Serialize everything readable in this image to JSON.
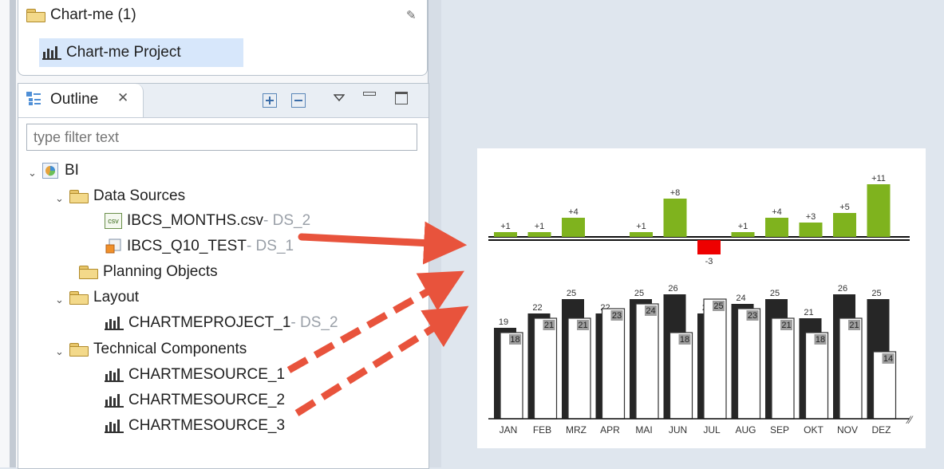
{
  "projects": {
    "root_label": "Chart-me (1)",
    "project_label": "Chart-me Project"
  },
  "outline": {
    "tab_label": "Outline",
    "filter_placeholder": "type filter text",
    "tree": {
      "root": "BI",
      "data_sources": "Data Sources",
      "ds_file_1": "IBCS_MONTHS.csv",
      "ds_file_1_suffix": " - DS_2",
      "ds_file_2": "IBCS_Q10_TEST",
      "ds_file_2_suffix": " - DS_1",
      "planning": "Planning Objects",
      "layout": "Layout",
      "layout_item": "CHARTMEPROJECT_1",
      "layout_item_suffix": " - DS_2",
      "technical": "Technical Components",
      "source_1": "CHARTMESOURCE_1",
      "source_2": "CHARTMESOURCE_2",
      "source_3": "CHARTMESOURCE_3"
    }
  },
  "chart_data": [
    {
      "type": "bar",
      "categories": [
        "JAN",
        "FEB",
        "MRZ",
        "APR",
        "MAI",
        "JUN",
        "JUL",
        "AUG",
        "SEP",
        "OKT",
        "NOV",
        "DEZ"
      ],
      "values": [
        1,
        1,
        4,
        null,
        1,
        8,
        -3,
        1,
        4,
        3,
        5,
        11
      ],
      "labels": [
        "+1",
        "+1",
        "+4",
        "",
        "+1",
        "+8",
        "-3",
        "+1",
        "+4",
        "+3",
        "+5",
        "+11"
      ],
      "colors": {
        "positive": "#7fb31e",
        "negative": "#ee0000",
        "axis": "#111111"
      }
    },
    {
      "type": "bar",
      "categories": [
        "JAN",
        "FEB",
        "MRZ",
        "APR",
        "MAI",
        "JUN",
        "JUL",
        "AUG",
        "SEP",
        "OKT",
        "NOV",
        "DEZ"
      ],
      "series": [
        {
          "values": [
            19,
            22,
            25,
            22,
            25,
            26,
            22,
            24,
            25,
            21,
            26,
            25
          ],
          "labels": [
            "19",
            "22",
            "25",
            "22",
            "25",
            "26",
            "22",
            "24",
            "25",
            "21",
            "26",
            "25"
          ]
        },
        {
          "values": [
            18,
            21,
            21,
            23,
            24,
            18,
            25,
            23,
            21,
            18,
            21,
            14
          ],
          "labels": [
            "18",
            "21",
            "21",
            "23",
            "24",
            "18",
            "25",
            "23",
            "21",
            "18",
            "21",
            "14"
          ]
        }
      ],
      "colors": {
        "actual": "#262626",
        "plan": "#ffffff",
        "plan_stroke": "#333333",
        "label_box": "#9e9e9e"
      }
    }
  ]
}
